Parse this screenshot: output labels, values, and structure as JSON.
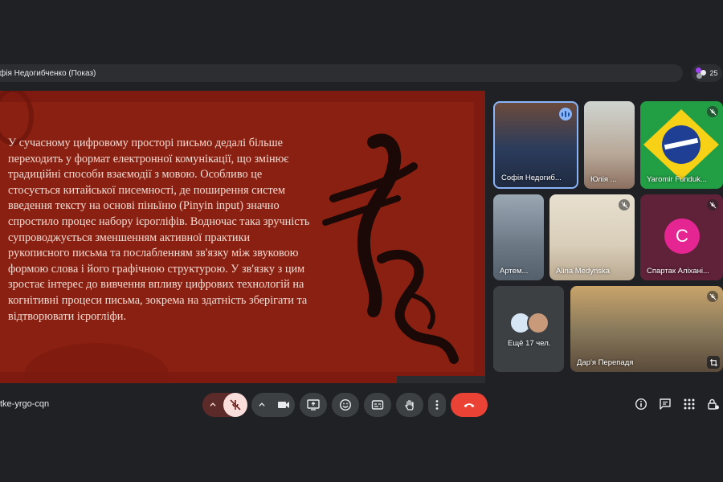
{
  "top_bar": {
    "presenter_label": "фія Недогибченко (Показ)",
    "participant_count": "25"
  },
  "slide": {
    "text": "У сучасному цифровому просторі письмо дедалі більше переходить у формат електронної комунікації, що змінює традиційні способи взаємодії з мовою. Особливо це стосується китайської писемності, де поширення систем введення тексту на основі піньїню (Pinyin input) значно спростило процес набору ієрогліфів. Водночас така зручність супроводжується зменшенням активної практики рукописного письма та послабленням зв'язку між звуковою формою слова і його графічною структурою. У зв'язку з цим зростає інтерес до вивчення впливу цифрових технологій на когнітивні процеси письма, зокрема на здатність зберігати та відтворювати ієрогліфи."
  },
  "participants": [
    {
      "name": "Софія Недогиб...",
      "speaking": true
    },
    {
      "name": "Юлія ..."
    },
    {
      "name": "Yaromir Funduk..."
    },
    {
      "name": "Артем..."
    },
    {
      "name": "Alina Medynska"
    },
    {
      "name": "Спартак Аліхані...",
      "initial": "С"
    },
    {
      "name": "Ещё 17 чел."
    },
    {
      "name": "Дар'я Перепадя"
    }
  ],
  "footer": {
    "meeting_code": "tke-yrgo-cqn"
  },
  "icons": {
    "mic_off": "mic-off-icon",
    "camera": "video-camera-icon",
    "present": "present-screen-icon",
    "emoji": "emoji-icon",
    "captions": "captions-icon",
    "hand": "raise-hand-icon",
    "more": "more-vertical-icon",
    "hangup": "hang-up-icon",
    "info": "info-icon",
    "chat": "chat-icon",
    "activities": "apps-grid-icon",
    "host": "host-controls-icon"
  },
  "colors": {
    "background": "#202124",
    "slide_red": "#8a2011",
    "hangup_red": "#ea4335",
    "mic_off_bg": "#f9dedc",
    "speaking_blue": "#8ab4f8",
    "avatar_pink": "#e52592"
  }
}
